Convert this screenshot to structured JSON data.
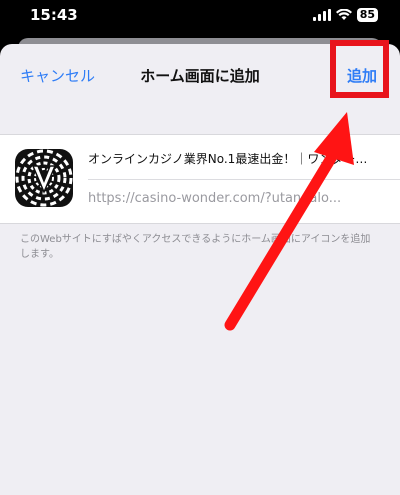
{
  "status": {
    "time": "15:43",
    "battery": "85"
  },
  "nav": {
    "cancel_label": "キャンセル",
    "title": "ホーム画面に追加",
    "add_label": "追加"
  },
  "card": {
    "page_title": "オンラインカジノ業界No.1最速出金！｜ワンダー…",
    "url": "https://casino-wonder.com/?utandalo..."
  },
  "description": "このWebサイトにすばやくアクセスできるようにホーム画面にアイコンを追加します。",
  "colors": {
    "accent": "#2f7df6",
    "highlight": "#e8141c",
    "sheet_background": "#efeef3"
  },
  "icons": [
    "signal-icon",
    "wifi-icon",
    "battery-icon",
    "app-icon",
    "arrow-annotation"
  ]
}
